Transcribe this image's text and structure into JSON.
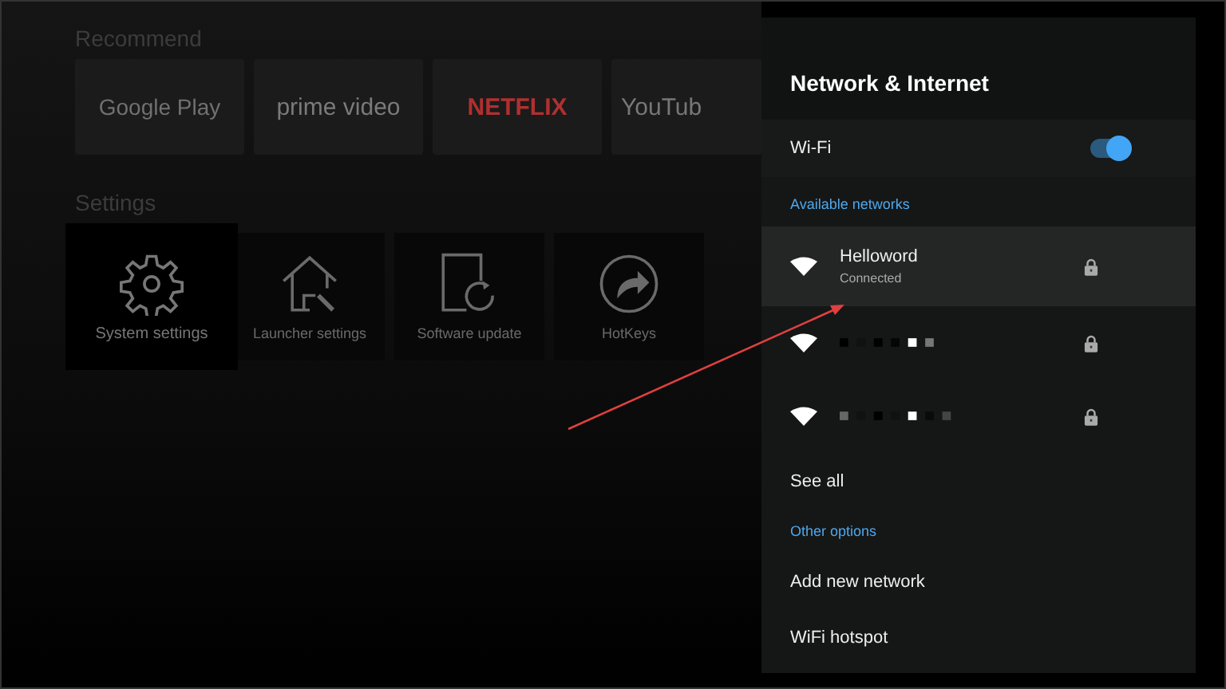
{
  "launcher": {
    "recommend_title": "Recommend",
    "apps": [
      {
        "kind": "play",
        "label": "Google Play"
      },
      {
        "kind": "prime",
        "label": "prime video"
      },
      {
        "kind": "netflix",
        "label": "NETFLIX"
      },
      {
        "kind": "youtube",
        "label": "YouTub"
      }
    ],
    "settings_title": "Settings",
    "settings": [
      {
        "kind": "gear",
        "label": "System settings",
        "selected": true
      },
      {
        "kind": "house",
        "label": "Launcher settings",
        "selected": false
      },
      {
        "kind": "update",
        "label": "Software update",
        "selected": false
      },
      {
        "kind": "hotkey",
        "label": "HotKeys",
        "selected": false
      }
    ]
  },
  "panel": {
    "title": "Network & Internet",
    "wifi": {
      "label": "Wi-Fi",
      "on": true
    },
    "available_header": "Available networks",
    "networks": [
      {
        "kind": "named",
        "name": "Helloword",
        "status": "Connected",
        "selected": true,
        "locked": true
      },
      {
        "kind": "hidden",
        "selected": false,
        "locked": true
      },
      {
        "kind": "hidden",
        "selected": false,
        "locked": true
      }
    ],
    "see_all": "See all",
    "other_header": "Other options",
    "options": [
      "Add new network",
      "WiFi hotspot"
    ]
  }
}
